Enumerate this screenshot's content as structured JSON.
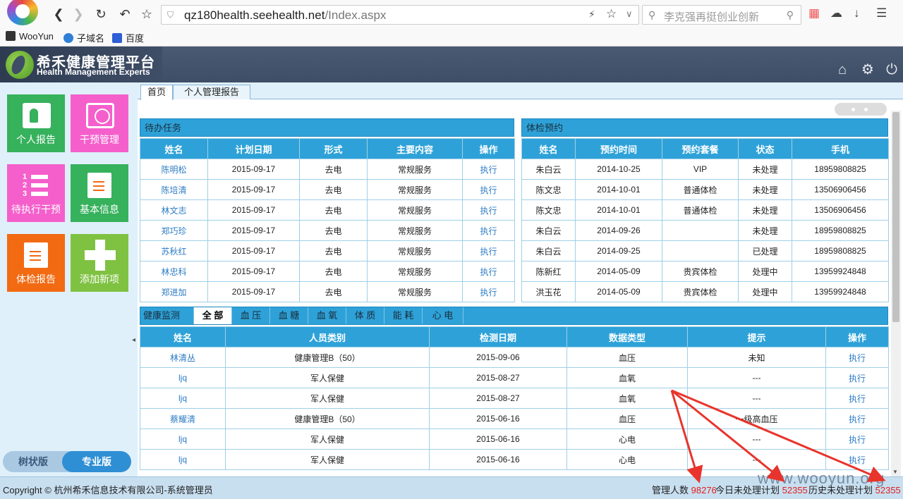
{
  "browser": {
    "url_host": "qz180health.seehealth.net",
    "url_path": "/Index.aspx",
    "search_placeholder": "李克强再挺创业创新",
    "bookmarks": [
      "WooYun",
      "子域名",
      "百度"
    ]
  },
  "app": {
    "title_cn": "希禾健康管理平台",
    "title_en": "Health Management Experts"
  },
  "sidebar": {
    "tiles": [
      {
        "label": "个人报告",
        "color": "#36b15c"
      },
      {
        "label": "干预管理",
        "color": "#f55fcb"
      },
      {
        "label": "待执行干预",
        "color": "#f55fcb"
      },
      {
        "label": "基本信息",
        "color": "#36b15c"
      },
      {
        "label": "体检报告",
        "color": "#f26a12"
      },
      {
        "label": "添加新项",
        "color": "#7fc242"
      }
    ],
    "versions": [
      "树状版",
      "专业版"
    ],
    "active_version": "专业版"
  },
  "tabs": [
    "首页",
    "个人管理报告"
  ],
  "pending": {
    "title": "待办任务",
    "columns": [
      "姓名",
      "计划日期",
      "形式",
      "主要内容",
      "操作"
    ],
    "rows": [
      [
        "陈明松",
        "2015-09-17",
        "去电",
        "常规服务",
        "执行"
      ],
      [
        "陈培清",
        "2015-09-17",
        "去电",
        "常规服务",
        "执行"
      ],
      [
        "林文志",
        "2015-09-17",
        "去电",
        "常规服务",
        "执行"
      ],
      [
        "郑巧珍",
        "2015-09-17",
        "去电",
        "常规服务",
        "执行"
      ],
      [
        "苏秋红",
        "2015-09-17",
        "去电",
        "常规服务",
        "执行"
      ],
      [
        "林忠科",
        "2015-09-17",
        "去电",
        "常规服务",
        "执行"
      ],
      [
        "郑进加",
        "2015-09-17",
        "去电",
        "常规服务",
        "执行"
      ]
    ]
  },
  "appointments": {
    "title": "体检预约",
    "columns": [
      "姓名",
      "预约时间",
      "预约套餐",
      "状态",
      "手机"
    ],
    "rows": [
      [
        "朱白云",
        "2014-10-25",
        "VIP",
        "未处理",
        "18959808825"
      ],
      [
        "陈文忠",
        "2014-10-01",
        "普通体检",
        "未处理",
        "13506906456"
      ],
      [
        "陈文忠",
        "2014-10-01",
        "普通体检",
        "未处理",
        "13506906456"
      ],
      [
        "朱白云",
        "2014-09-26",
        "",
        "未处理",
        "18959808825"
      ],
      [
        "朱白云",
        "2014-09-25",
        "",
        "已处理",
        "18959808825"
      ],
      [
        "陈新红",
        "2014-05-09",
        "贵宾体检",
        "处理中",
        "13959924848"
      ],
      [
        "洪玉花",
        "2014-05-09",
        "贵宾体检",
        "处理中",
        "13959924848"
      ]
    ]
  },
  "monitor": {
    "title": "健康监测",
    "filters": [
      "全 部",
      "血 压",
      "血 糖",
      "血 氧",
      "体 质",
      "能 耗",
      "心 电"
    ],
    "active_filter": "全 部",
    "columns": [
      "姓名",
      "人员类别",
      "检测日期",
      "数据类型",
      "提示",
      "操作"
    ],
    "rows": [
      [
        "林清丛",
        "健康管理B（50）",
        "2015-09-06",
        "血压",
        "未知",
        "执行"
      ],
      [
        "ljq",
        "军人保健",
        "2015-08-27",
        "血氧",
        "---",
        "执行"
      ],
      [
        "ljq",
        "军人保健",
        "2015-08-27",
        "血氧",
        "---",
        "执行"
      ],
      [
        "蔡耀清",
        "健康管理B（50）",
        "2015-06-16",
        "血压",
        "一级高血压",
        "执行"
      ],
      [
        "ljq",
        "军人保健",
        "2015-06-16",
        "心电",
        "---",
        "执行"
      ],
      [
        "ljq",
        "军人保健",
        "2015-06-16",
        "心电",
        "---",
        "执行"
      ]
    ]
  },
  "footer": {
    "copyright": "Copyright © 杭州希禾信息技术有限公司-系统管理员",
    "managed_label": "管理人数",
    "managed_value": "98276",
    "today_label": "今日未处理计划",
    "today_value": "52355",
    "history_label": "历史未处理计划",
    "history_value": "52355"
  },
  "watermark": "www.wooyun.org",
  "colors": {
    "accent": "#2ea2d8",
    "header": "#3f4e67",
    "highlight_arrow": "#e8342c",
    "footer_number": "#e02020"
  }
}
